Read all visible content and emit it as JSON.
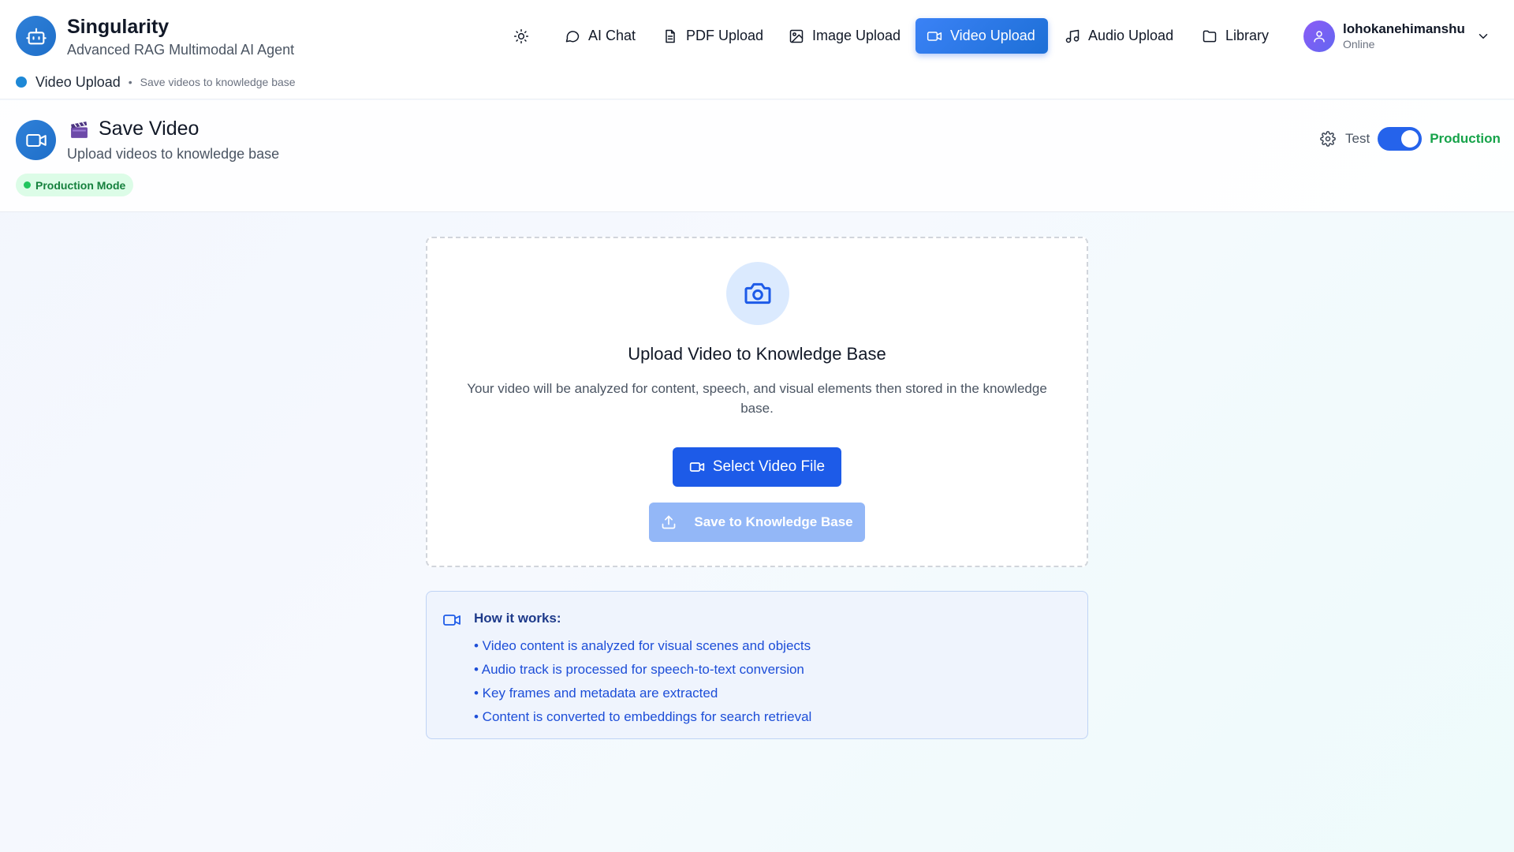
{
  "brand": {
    "name": "Singularity",
    "subtitle": "Advanced RAG Multimodal AI Agent",
    "logo_icon": "robot-icon"
  },
  "breadcrumb": {
    "current": "Video Upload",
    "separator": "•",
    "description": "Save videos to knowledge base"
  },
  "nav": {
    "theme_icon": "sun-icon",
    "items": [
      {
        "label": "AI Chat",
        "icon": "chat-bubble-icon",
        "active": false
      },
      {
        "label": "PDF Upload",
        "icon": "document-icon",
        "active": false
      },
      {
        "label": "Image Upload",
        "icon": "image-icon",
        "active": false
      },
      {
        "label": "Video Upload",
        "icon": "video-camera-icon",
        "active": true
      },
      {
        "label": "Audio Upload",
        "icon": "music-note-icon",
        "active": false
      },
      {
        "label": "Library",
        "icon": "folder-icon",
        "active": false
      }
    ]
  },
  "user": {
    "name": "lohokanehimanshu",
    "status": "Online"
  },
  "page": {
    "emoji": "🎬",
    "title": "Save Video",
    "subtitle": "Upload videos to knowledge base",
    "mode_badge": "Production Mode",
    "env": {
      "left_label": "Test",
      "right_label": "Production",
      "production_on": true
    }
  },
  "upload": {
    "title": "Upload Video to Knowledge Base",
    "description": "Your video will be analyzed for content, speech, and visual elements then stored in the knowledge base.",
    "select_label": "Select Video File",
    "save_label": "Save to Knowledge Base"
  },
  "how_it_works": {
    "title": "How it works:",
    "items": [
      "• Video content is analyzed for visual scenes and objects",
      "• Audio track is processed for speech-to-text conversion",
      "• Key frames and metadata are extracted",
      "• Content is converted to embeddings for search retrieval"
    ]
  },
  "colors": {
    "accent": "#1d5be8",
    "brand_blue": "#1f6fc9",
    "production_green": "#16a34a",
    "disabled_button": "#93b7f7"
  }
}
